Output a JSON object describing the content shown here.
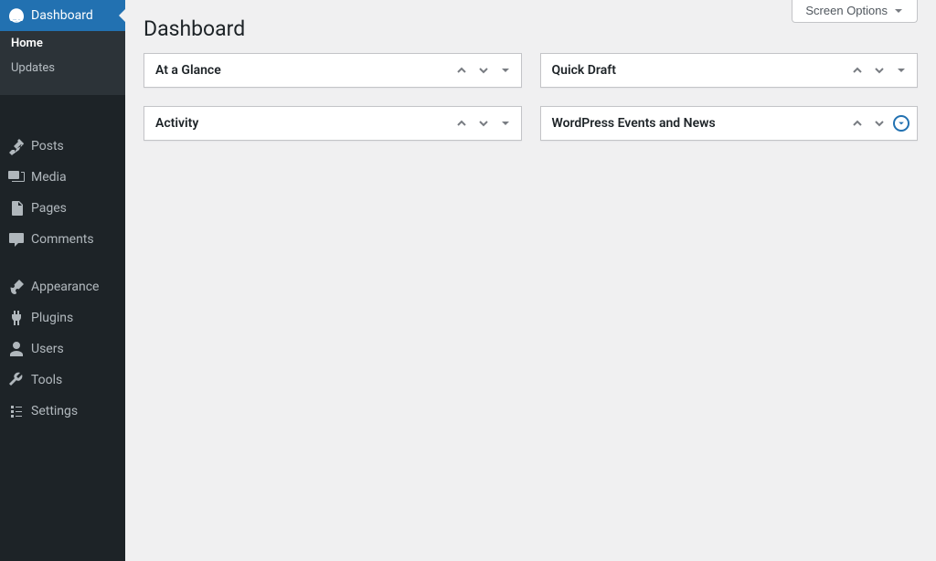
{
  "header": {
    "screen_options": "Screen Options",
    "title": "Dashboard"
  },
  "sidebar": {
    "dashboard": "Dashboard",
    "home": "Home",
    "updates": "Updates",
    "extra": "",
    "posts": "Posts",
    "media": "Media",
    "pages": "Pages",
    "comments": "Comments",
    "appearance": "Appearance",
    "plugins": "Plugins",
    "users": "Users",
    "tools": "Tools",
    "settings": "Settings"
  },
  "metaboxes": {
    "glance": "At a Glance",
    "activity": "Activity",
    "quickdraft": "Quick Draft",
    "events": "WordPress Events and News"
  }
}
